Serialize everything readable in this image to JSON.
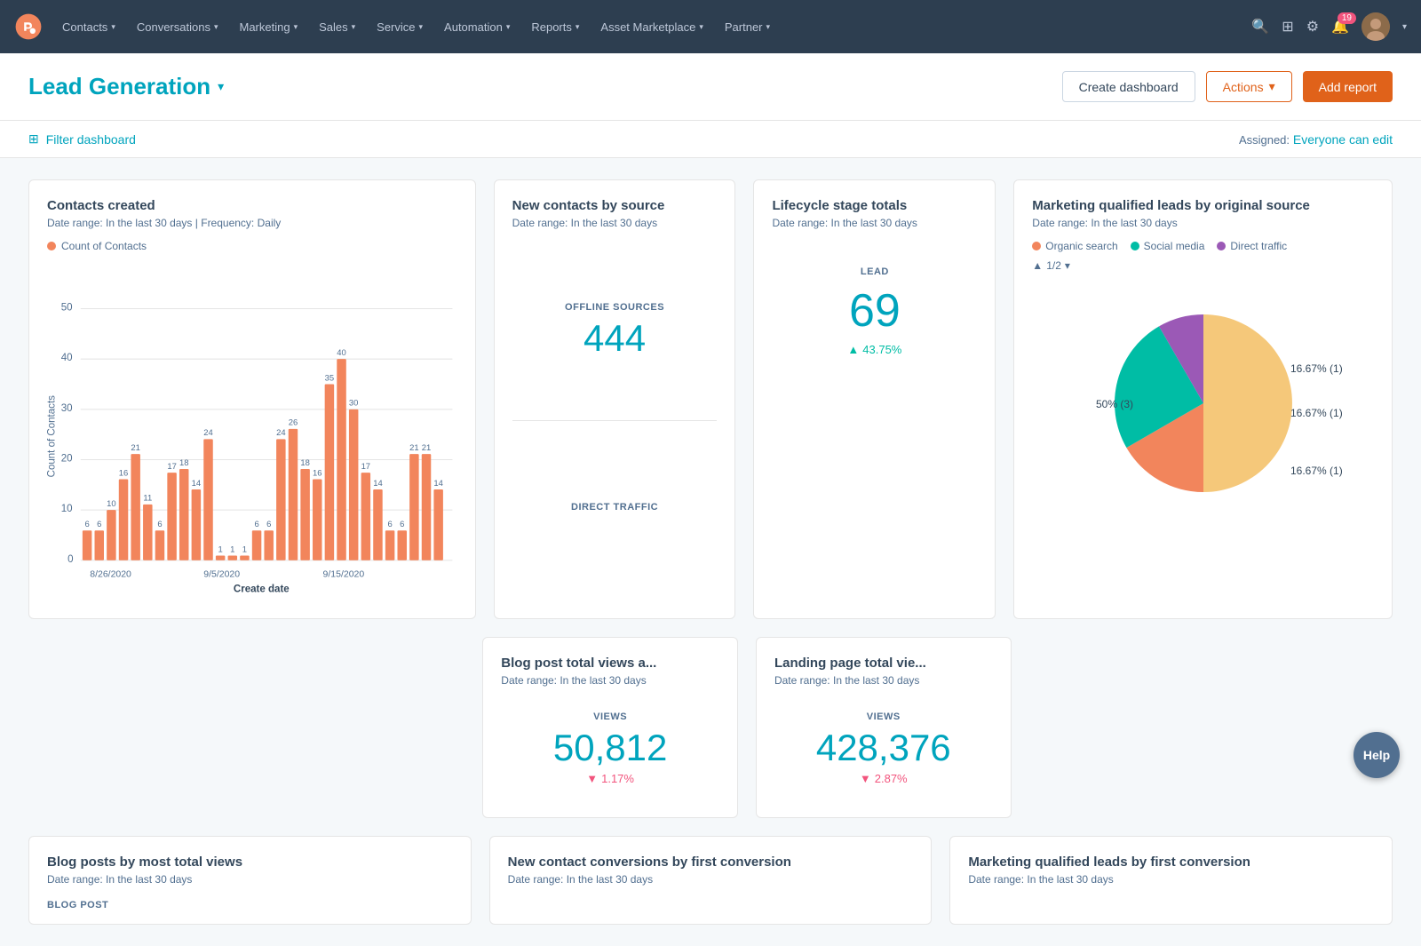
{
  "nav": {
    "items": [
      {
        "label": "Contacts",
        "id": "contacts"
      },
      {
        "label": "Conversations",
        "id": "conversations"
      },
      {
        "label": "Marketing",
        "id": "marketing"
      },
      {
        "label": "Sales",
        "id": "sales"
      },
      {
        "label": "Service",
        "id": "service"
      },
      {
        "label": "Automation",
        "id": "automation"
      },
      {
        "label": "Reports",
        "id": "reports"
      },
      {
        "label": "Asset Marketplace",
        "id": "asset-marketplace"
      },
      {
        "label": "Partner",
        "id": "partner"
      }
    ],
    "notification_count": "19"
  },
  "header": {
    "title": "Lead Generation",
    "create_dashboard_label": "Create dashboard",
    "actions_label": "Actions",
    "add_report_label": "Add report"
  },
  "filter_bar": {
    "filter_label": "Filter dashboard",
    "assigned_label": "Assigned:",
    "assigned_value": "Everyone can edit"
  },
  "cards": {
    "contacts_created": {
      "title": "Contacts created",
      "date_range": "Date range: In the last 30 days",
      "frequency": "Frequency: Daily",
      "legend": "Count of Contacts",
      "y_max": 50,
      "bars": [
        {
          "date": "8/26",
          "value": 6
        },
        {
          "date": "8/27",
          "value": 6
        },
        {
          "date": "8/28",
          "value": 10
        },
        {
          "date": "8/29",
          "value": 16
        },
        {
          "date": "8/30",
          "value": 21
        },
        {
          "date": "8/31",
          "value": 11
        },
        {
          "date": "9/1",
          "value": 6
        },
        {
          "date": "9/2",
          "value": 17
        },
        {
          "date": "9/3",
          "value": 18
        },
        {
          "date": "9/4",
          "value": 14
        },
        {
          "date": "9/5",
          "value": 24
        },
        {
          "date": "9/6",
          "value": 1
        },
        {
          "date": "9/7",
          "value": 1
        },
        {
          "date": "9/8",
          "value": 1
        },
        {
          "date": "9/9",
          "value": 6
        },
        {
          "date": "9/10",
          "value": 6
        },
        {
          "date": "9/11",
          "value": 24
        },
        {
          "date": "9/12",
          "value": 26
        },
        {
          "date": "9/13",
          "value": 18
        },
        {
          "date": "9/14",
          "value": 16
        },
        {
          "date": "9/15",
          "value": 35
        },
        {
          "date": "9/16",
          "value": 40
        },
        {
          "date": "9/17",
          "value": 30
        },
        {
          "date": "9/18",
          "value": 17
        },
        {
          "date": "9/19",
          "value": 14
        },
        {
          "date": "9/20",
          "value": 6
        },
        {
          "date": "9/21",
          "value": 6
        },
        {
          "date": "9/22",
          "value": 21
        },
        {
          "date": "9/23",
          "value": 21
        },
        {
          "date": "9/24",
          "value": 14
        },
        {
          "date": "9/25",
          "value": 0
        },
        {
          "date": "9/26",
          "value": 0
        }
      ],
      "x_labels": [
        "8/26/2020",
        "9/5/2020",
        "9/15/2020"
      ],
      "x_axis_label": "Create date",
      "y_labels": [
        "0",
        "10",
        "20",
        "30",
        "40",
        "50"
      ]
    },
    "new_contacts_by_source": {
      "title": "New contacts by source",
      "date_range": "Date range: In the last 30 days",
      "offline_label": "OFFLINE SOURCES",
      "offline_value": "444",
      "direct_label": "DIRECT TRAFFIC",
      "direct_value": ""
    },
    "lifecycle_stage": {
      "title": "Lifecycle stage totals",
      "date_range": "Date range: In the last 30 days",
      "lead_label": "LEAD",
      "lead_value": "69",
      "change": "43.75%",
      "change_direction": "up"
    },
    "mql_by_source": {
      "title": "Marketing qualified leads by original source",
      "date_range": "Date range: In the last 30 days",
      "legend": [
        {
          "label": "Organic search",
          "color": "#f2855c"
        },
        {
          "label": "Social media",
          "color": "#00bda5"
        },
        {
          "label": "Direct traffic",
          "color": "#9b59b6"
        }
      ],
      "page": "1/2",
      "slices": [
        {
          "label": "50% (3)",
          "value": 50,
          "color": "#f5c87a",
          "position": "left"
        },
        {
          "label": "16.67% (1)",
          "value": 16.67,
          "color": "#f2855c",
          "position": "top-right"
        },
        {
          "label": "16.67% (1)",
          "value": 16.67,
          "color": "#00bda5",
          "position": "right"
        },
        {
          "label": "16.67% (1)",
          "value": 16.67,
          "color": "#9b59b6",
          "position": "bottom-right"
        }
      ]
    },
    "blog_post_views": {
      "title": "Blog post total views a...",
      "date_range": "Date range: In the last 30 days",
      "views_label": "VIEWS",
      "views_value": "50,812",
      "change": "1.17%",
      "change_direction": "down"
    },
    "landing_page_views": {
      "title": "Landing page total vie...",
      "date_range": "Date range: In the last 30 days",
      "views_label": "VIEWS",
      "views_value": "428,376",
      "change": "2.87%",
      "change_direction": "down"
    },
    "blog_posts_most_views": {
      "title": "Blog posts by most total views",
      "date_range": "Date range: In the last 30 days",
      "col_label": "BLOG POST"
    },
    "new_contact_conversions": {
      "title": "New contact conversions by first conversion",
      "date_range": "Date range: In the last 30 days"
    },
    "mql_by_conversion": {
      "title": "Marketing qualified leads by first conversion",
      "date_range": "Date range: In the last 30 days"
    }
  },
  "help": {
    "label": "Help"
  },
  "colors": {
    "teal": "#00a4bd",
    "orange": "#e0621a",
    "bar": "#f2855c",
    "up_green": "#00bda5",
    "down_red": "#f2547d"
  }
}
